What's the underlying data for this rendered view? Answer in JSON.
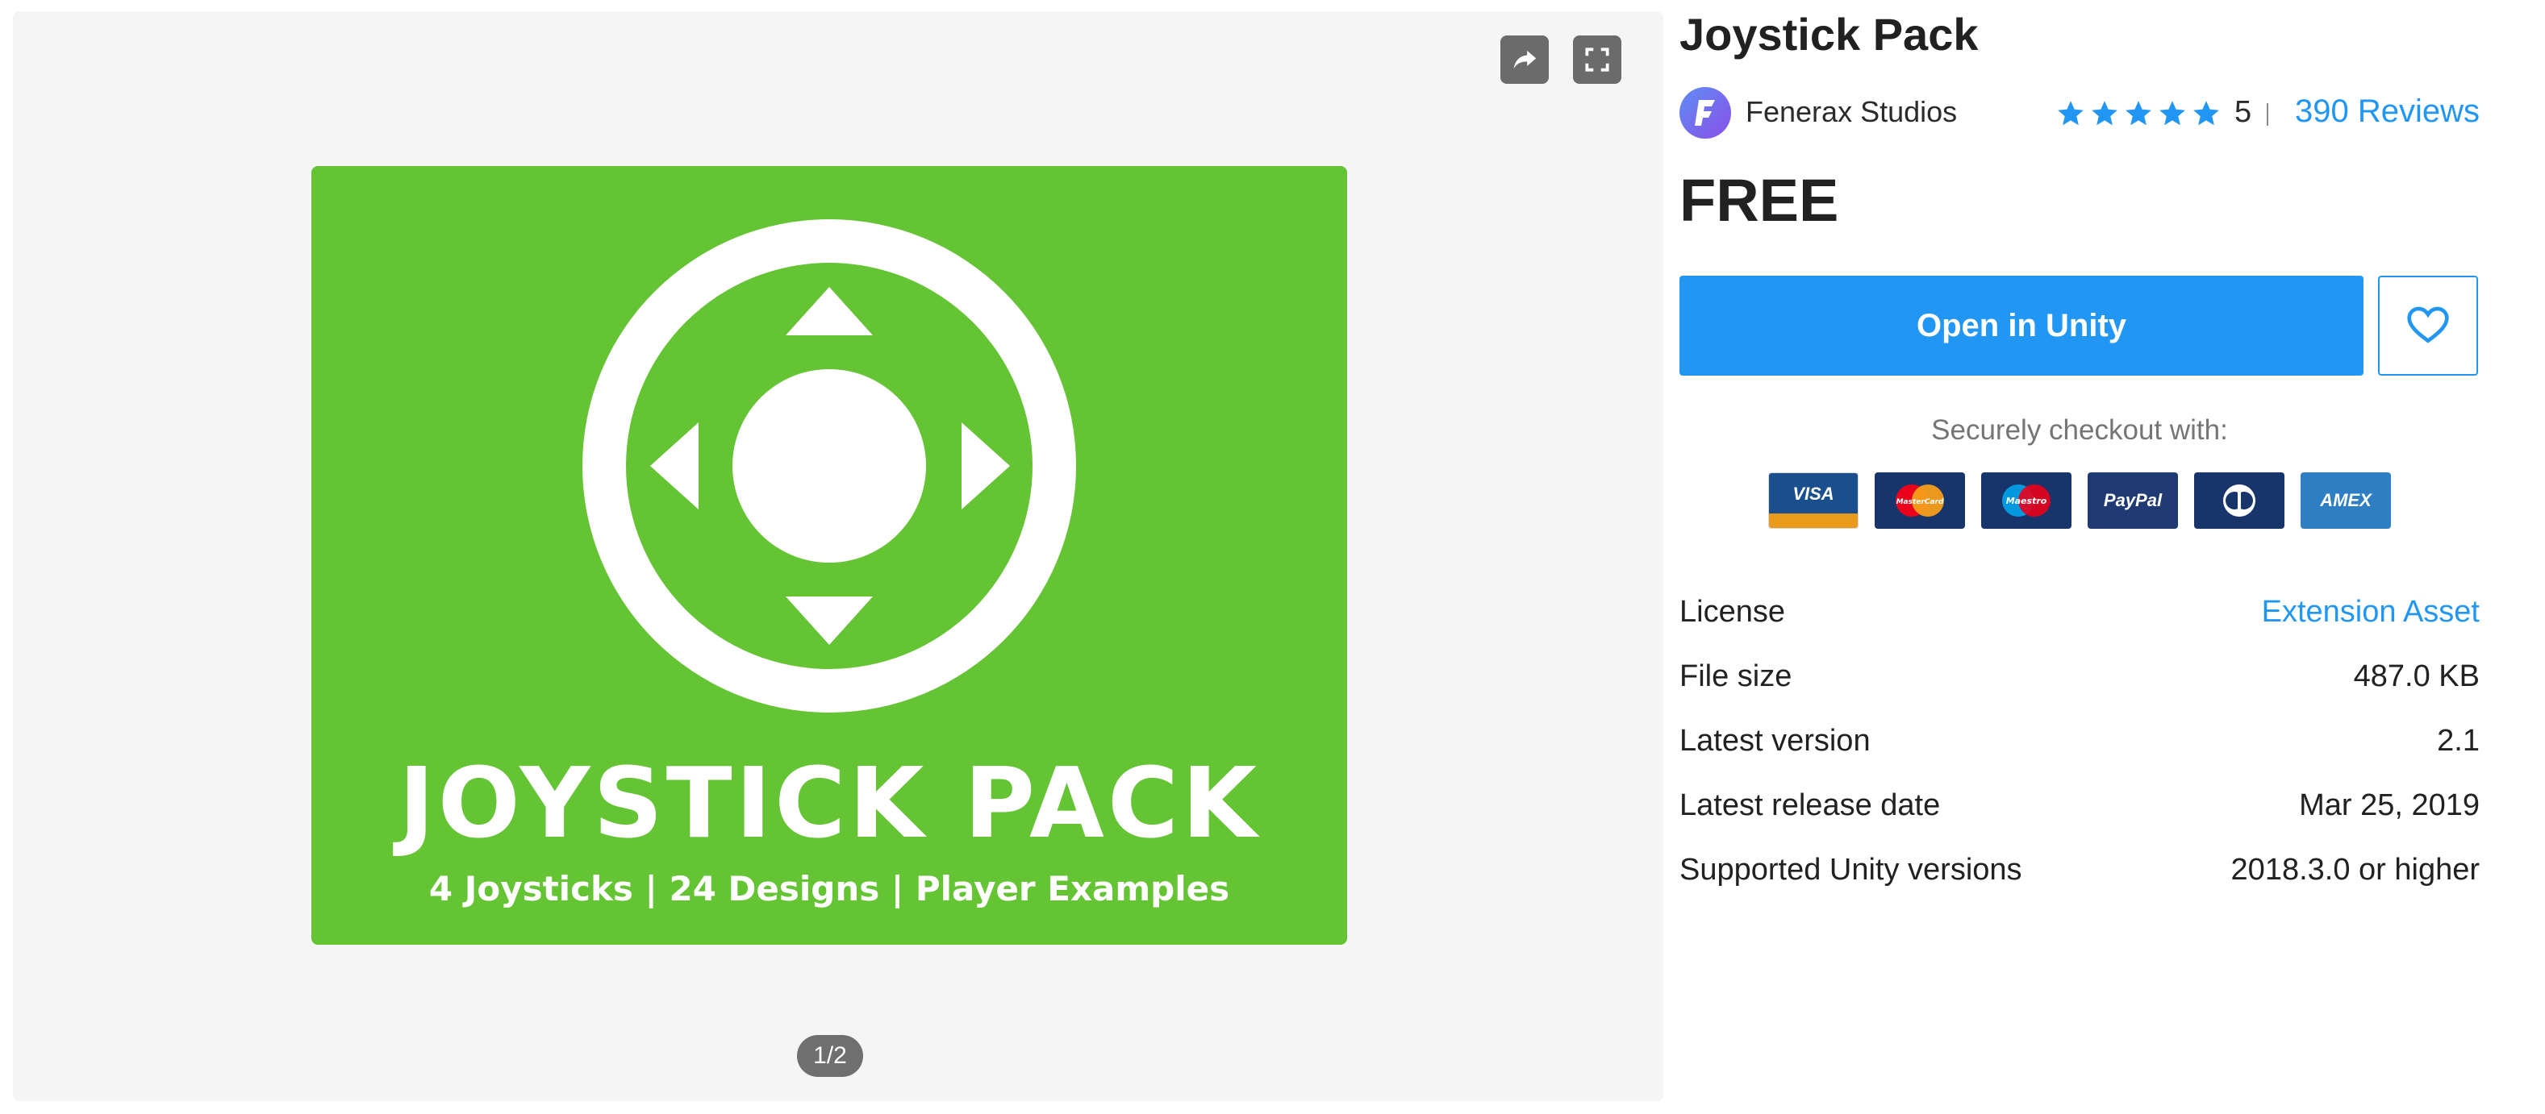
{
  "gallery": {
    "share_icon": "share-arrow-icon",
    "fullscreen_icon": "fullscreen-icon",
    "hero": {
      "title": "JOYSTICK PACK",
      "subtitle": "4 Joysticks | 24 Designs | Player Examples",
      "background_color": "#65c434"
    },
    "pager": "1/2"
  },
  "product": {
    "title": "Joystick Pack",
    "publisher": "Fenerax Studios",
    "rating": "5",
    "stars": 5,
    "reviews": "390 Reviews",
    "price": "FREE",
    "open_button": "Open in Unity",
    "favorite_icon": "heart-icon"
  },
  "checkout": {
    "label": "Securely checkout with:",
    "cards": [
      "VISA",
      "MasterCard",
      "Maestro",
      "PayPal",
      "Diners Club",
      "AMEX"
    ]
  },
  "details": {
    "license_label": "License",
    "license_value": "Extension Asset",
    "file_size_label": "File size",
    "file_size_value": "487.0 KB",
    "version_label": "Latest version",
    "version_value": "2.1",
    "release_label": "Latest release date",
    "release_value": "Mar 25, 2019",
    "unity_label": "Supported Unity versions",
    "unity_value": "2018.3.0 or higher"
  },
  "colors": {
    "accent": "#2196f3",
    "text": "#212121",
    "gallery_bg": "#f5f5f5"
  }
}
